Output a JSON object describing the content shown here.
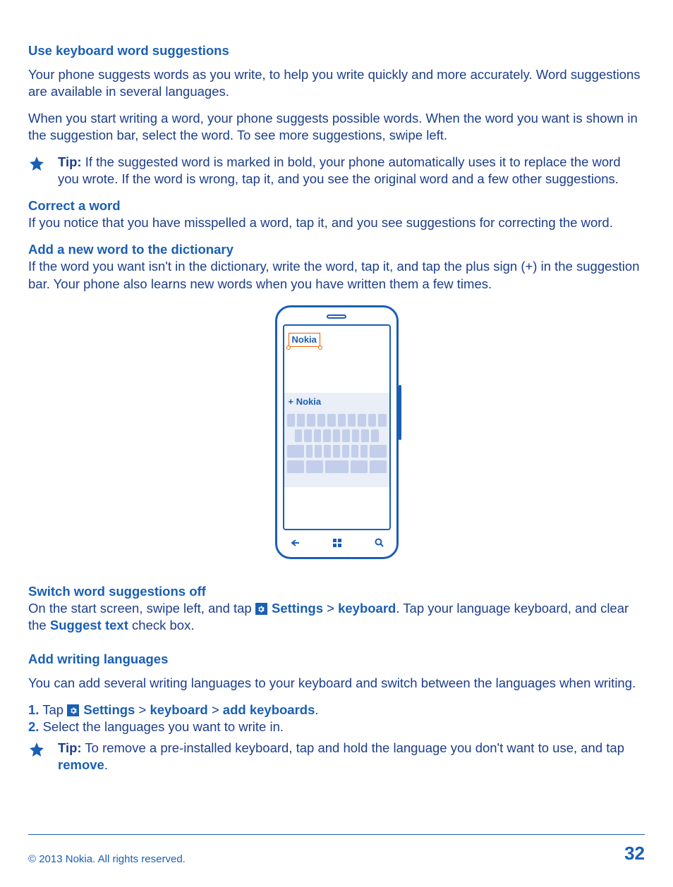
{
  "s1": {
    "title": "Use keyboard word suggestions",
    "p1": "Your phone suggests words as you write, to help you write quickly and more accurately. Word suggestions are available in several languages.",
    "p2": "When you start writing a word, your phone suggests possible words. When the word you want is shown in the suggestion bar, select the word. To see more suggestions, swipe left.",
    "tip_label": "Tip:",
    "tip_body": " If the suggested word is marked in bold, your phone automatically uses it to replace the word you wrote. If the word is wrong, tap it, and you see the original word and a few other suggestions."
  },
  "s2": {
    "title": "Correct a word",
    "body": "If you notice that you have misspelled a word, tap it, and you see suggestions for correcting the word."
  },
  "s3": {
    "title": "Add a new word to the dictionary",
    "body": "If the word you want isn't in the dictionary, write the word, tap it, and tap the plus sign (+) in the suggestion bar. Your phone also learns new words when you have written them a few times."
  },
  "phone": {
    "typed": "Nokia",
    "suggestion_prefix": "+ ",
    "suggestion": "Nokia"
  },
  "s4": {
    "title": "Switch word suggestions off",
    "pre": "On the start screen, swipe left, and tap ",
    "settings": "Settings",
    "sep": " > ",
    "keyboard": "keyboard",
    "post1": ". Tap your language keyboard, and clear the ",
    "suggest_text": "Suggest text",
    "post2": " check box."
  },
  "s5": {
    "title": "Add writing languages",
    "p1": "You can add several writing languages to your keyboard and switch between the languages when writing.",
    "n1": "1.",
    "n1_tap": " Tap ",
    "n1_settings": "Settings",
    "sep": " > ",
    "n1_keyboard": "keyboard",
    "n1_add": "add keyboards",
    "n1_end": ".",
    "n2": "2.",
    "n2_body": " Select the languages you want to write in.",
    "tip_label": "Tip:",
    "tip_pre": " To remove a pre-installed keyboard, tap and hold the language you don't want to use, and tap ",
    "tip_remove": "remove",
    "tip_end": "."
  },
  "footer": {
    "copyright": "© 2013 Nokia. All rights reserved.",
    "page": "32"
  }
}
